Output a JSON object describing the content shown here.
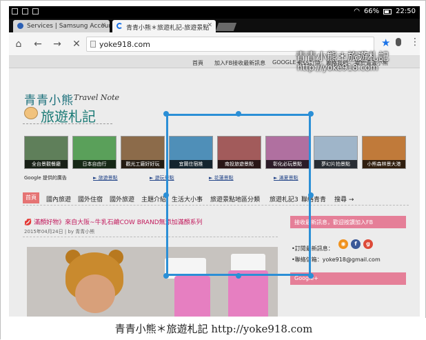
{
  "status_bar": {
    "signal_text": "",
    "battery": "66%",
    "time": "22:50"
  },
  "tabs": [
    {
      "title": "Services | Samsung Account",
      "active": false
    },
    {
      "title": "青青小熊＊旅遊札記-旅遊景點",
      "active": true
    }
  ],
  "address_bar": {
    "url": "yoke918.com"
  },
  "site_nav": {
    "items": [
      "首頁",
      "加入FB接收最新訊息",
      "GOOGLE+",
      "RSS訂閱",
      "聯絡我們",
      "關於青青小熊"
    ]
  },
  "logo": {
    "title": "青青小熊",
    "subtitle": "旅遊札記",
    "tagline": "Travel Note"
  },
  "thumbnails": [
    {
      "caption": "全台景觀餐廳",
      "color": "#5f7f5a"
    },
    {
      "caption": "日本自由行",
      "color": "#5aa05a"
    },
    {
      "caption": "觀光工廠好好玩",
      "color": "#8c6b4a"
    },
    {
      "caption": "宜蘭住宿推",
      "color": "#4f8fb8"
    },
    {
      "caption": "南投旅遊景點",
      "color": "#a25b5b"
    },
    {
      "caption": "彰化必玩景點",
      "color": "#b070a0"
    },
    {
      "caption": "夢幻片拍景點",
      "color": "#9fb5c9"
    },
    {
      "caption": "小熊森林景大港",
      "color": "#c07a3a"
    }
  ],
  "ad_label": "Google 提供的廣告",
  "sublinks": [
    "► 旅遊景點",
    "► 遊玩景點",
    "► 花蓮景點",
    "► 滿夏景點"
  ],
  "category_nav": {
    "home": "首頁",
    "items": [
      "國內旅遊",
      "國外住宿",
      "國外旅遊",
      "主題介紹",
      "生活大小事",
      "旅遊景點地區分類",
      "旅遊札記3",
      "聯絡青青",
      "搜尋 →"
    ]
  },
  "post": {
    "title": "💋 滿顏好物》來自大阪~牛乳石鹼COW BRAND無添加滿顏系列",
    "meta": "2015年04月24日 | by 青青小熊"
  },
  "sidebar": {
    "banner": "接收最新訊息，歡迎按讚加入FB",
    "subscribe_label": "•訂閱最新訊息：",
    "mail_label": "•聯絡信箱：yoke918@gmail.com",
    "google_label": "Google+",
    "social": [
      {
        "icon": "rss",
        "text": "◉",
        "color": "#f0921e"
      },
      {
        "icon": "facebook",
        "text": "f",
        "color": "#3b5998"
      },
      {
        "icon": "google-plus",
        "text": "g",
        "color": "#dd4b39"
      }
    ]
  },
  "watermark": {
    "line1": "青青小熊＊旅遊札記",
    "line2": "http://yoke918.com"
  },
  "footer": {
    "text": "青青小熊＊旅遊札記  http://yoke918.com"
  }
}
